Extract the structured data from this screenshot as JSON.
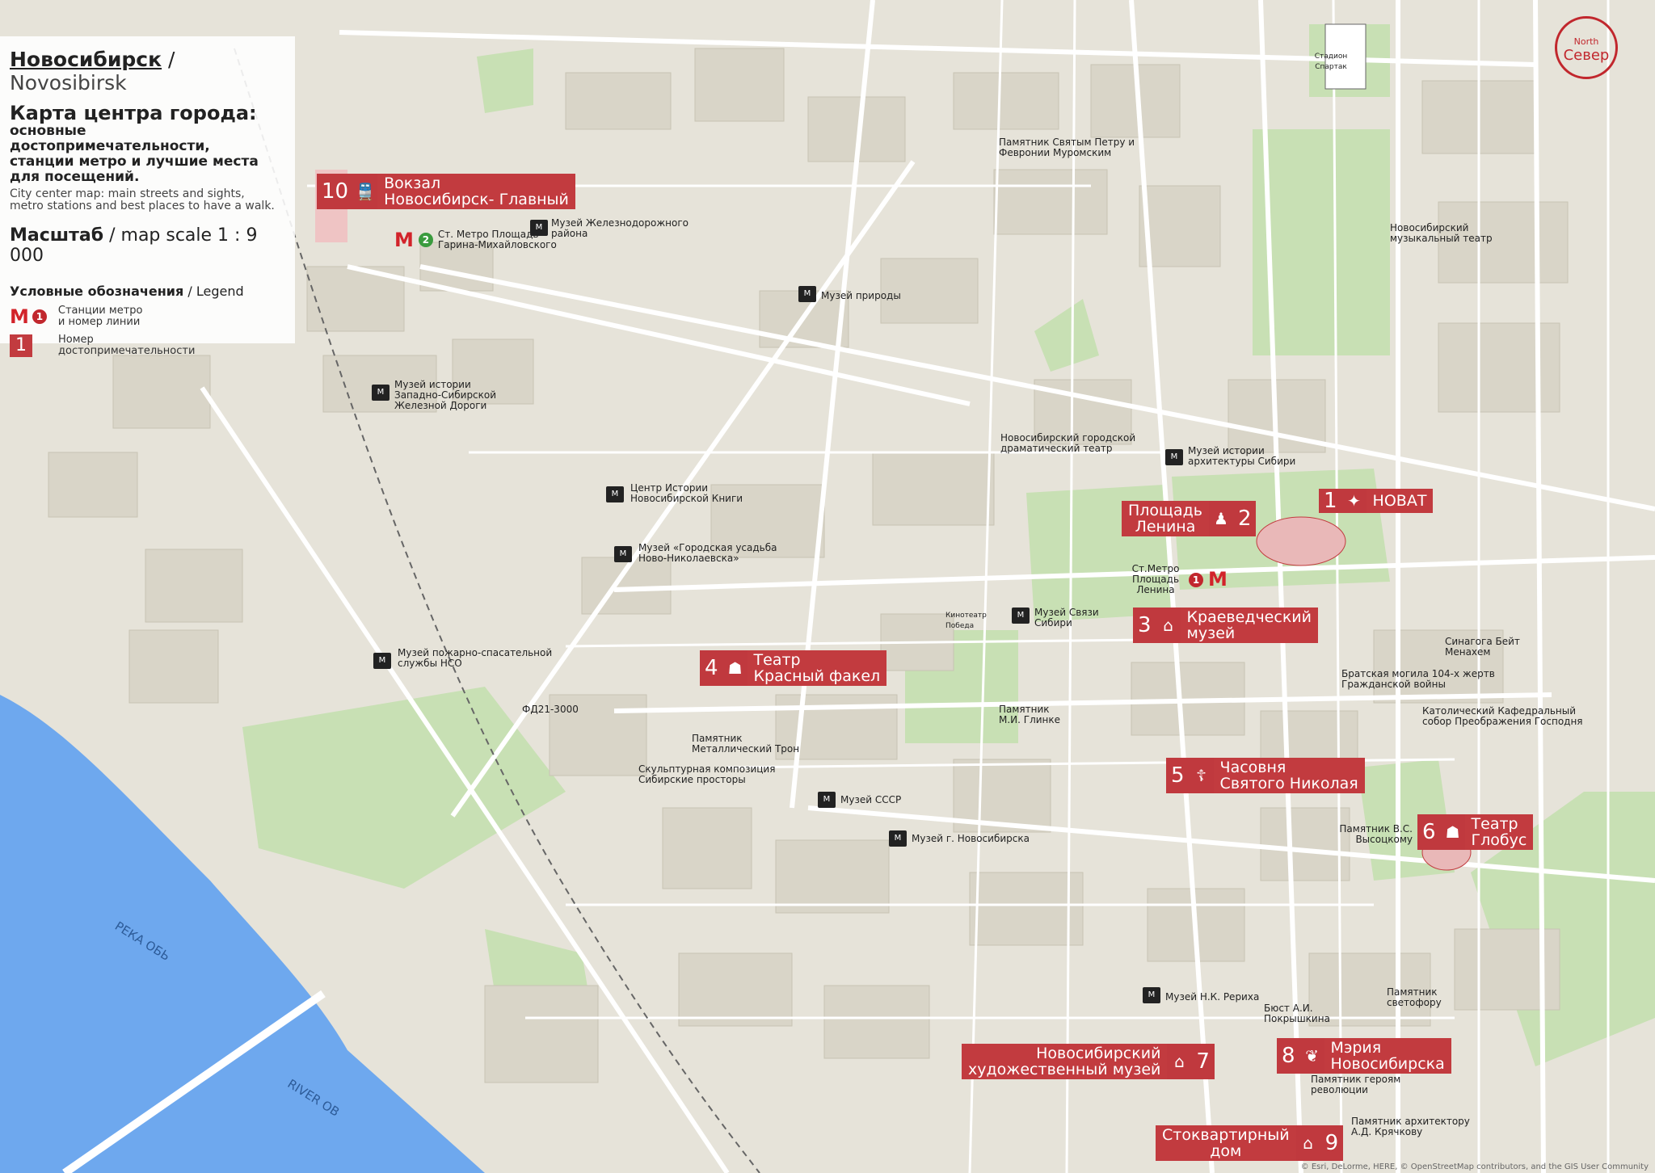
{
  "header": {
    "city_ru": "Новосибирск",
    "city_sep": " / ",
    "city_en": "Novosibirsk",
    "title": "Карта центра города:",
    "subtitle_1": "основные достопримечательности,",
    "subtitle_2": "станции метро и лучшие места",
    "subtitle_3": "для посещений.",
    "en_sub_1": "City center map: main streets and sights,",
    "en_sub_2": "metro stations and best places to have a walk.",
    "scale_ru": "Масштаб",
    "scale_en": " / map scale  1 : 9 000"
  },
  "legend": {
    "title_ru": "Условные обозначения",
    "title_en": " / Legend",
    "metro_symbol": "М",
    "metro_num": "1",
    "metro_text_1": "Станции метро",
    "metro_text_2": "и номер линии",
    "poi_num": "1",
    "poi_text_1": "Номер",
    "poi_text_2": "достопримечательности"
  },
  "north": {
    "en": "North",
    "ru": "Север"
  },
  "pois": [
    {
      "num": "10",
      "icon": "train-icon",
      "glyph": "🚆",
      "name_1": "Вокзал",
      "name_2": "Новосибирск- Главный"
    },
    {
      "num": "2",
      "icon": "monument-icon",
      "glyph": "♟",
      "name_1": "Площадь",
      "name_2": "Ленина"
    },
    {
      "num": "1",
      "icon": "ballet-icon",
      "glyph": "✦",
      "name_1": "НОВАТ",
      "name_2": ""
    },
    {
      "num": "3",
      "icon": "museum-icon",
      "glyph": "⌂",
      "name_1": "Краеведческий",
      "name_2": "музей"
    },
    {
      "num": "4",
      "icon": "theater-icon",
      "glyph": "☗",
      "name_1": "Театр",
      "name_2": "Красный факел"
    },
    {
      "num": "5",
      "icon": "chapel-icon",
      "glyph": "☦",
      "name_1": "Часовня",
      "name_2": "Святого Николая"
    },
    {
      "num": "6",
      "icon": "theater-icon",
      "glyph": "☗",
      "name_1": "Театр",
      "name_2": "Глобус"
    },
    {
      "num": "7",
      "icon": "museum-icon",
      "glyph": "⌂",
      "name_1": "Новосибирский",
      "name_2": "художественный музей"
    },
    {
      "num": "8",
      "icon": "coat-of-arms-icon",
      "glyph": "❦",
      "name_1": "Мэрия",
      "name_2": "Новосибирска"
    },
    {
      "num": "9",
      "icon": "museum-icon",
      "glyph": "⌂",
      "name_1": "Стоквартирный",
      "name_2": "дом"
    }
  ],
  "metro": [
    {
      "name": "Ст. Метро Площадь Гарина-Михайловского",
      "line": "2"
    },
    {
      "name": "Ст.Метро Площадь Ленина",
      "line": "1"
    }
  ],
  "labels": {
    "museum_railway_district": "Музей Железнодорожного района",
    "museum_nature": "Музей природы",
    "museum_west_siberian_railway": "Музей истории Западно-Сибирской Железной Дороги",
    "center_history_book": "Центр Истории Новосибирской Книги",
    "museum_estate": "Музей «Городская усадьба Ново-Николаевска»",
    "museum_fire": "Музей пожарно-спасательной службы НСО",
    "drama_theater": "Новосибирский городской драматический театр",
    "museum_architecture": "Музей истории архитектуры Сибири",
    "monument_peter_fevronia": "Памятник Святым Петру и Февронии Муромским",
    "music_theater": "Новосибирский музыкальный театр",
    "stadium": "Стадион Спартак",
    "cinema_pobeda": "Кинотеатр Победа",
    "museum_communications": "Музей Связи Сибири",
    "monument_glinka": "Памятник М.И. Глинке",
    "monument_metal_throne": "Памятник Металлический Трон",
    "sculpture_siberian": "Скульптурная композиция Сибирские просторы",
    "museum_ussr": "Музей СССР",
    "museum_city": "Музей г. Новосибирска",
    "fd21": "ФД21-3000",
    "synagogue": "Синагога Бейт Менахем",
    "mass_grave": "Братская могила 104-х жертв Гражданской войны",
    "catholic_cathedral": "Католический Кафедральный собор Преображения Господня",
    "monument_vysotsky": "Памятник В.С. Высоцкому",
    "museum_roerich": "Музей Н.К. Рериха",
    "monument_pokryshkin": "Бюст А.И. Покрышкина",
    "monument_traffic_light": "Памятник светофору",
    "monument_revolution": "Памятник героям революции",
    "monument_kryachkov": "Памятник архитектору А.Д. Крячкову",
    "river_ru": "РЕКА ОБЬ",
    "river_en": "RIVER OB",
    "attribution": "© Esri, DeLorme, HERE, © OpenStreetMap contributors, and the GIS User Community"
  },
  "colors": {
    "poi_red": "#c23b3f",
    "metro_red": "#d2232a",
    "park_green": "#c8e0b4",
    "water": "#6ea8ee",
    "road": "#ffffff",
    "block": "#d9d5c8"
  }
}
